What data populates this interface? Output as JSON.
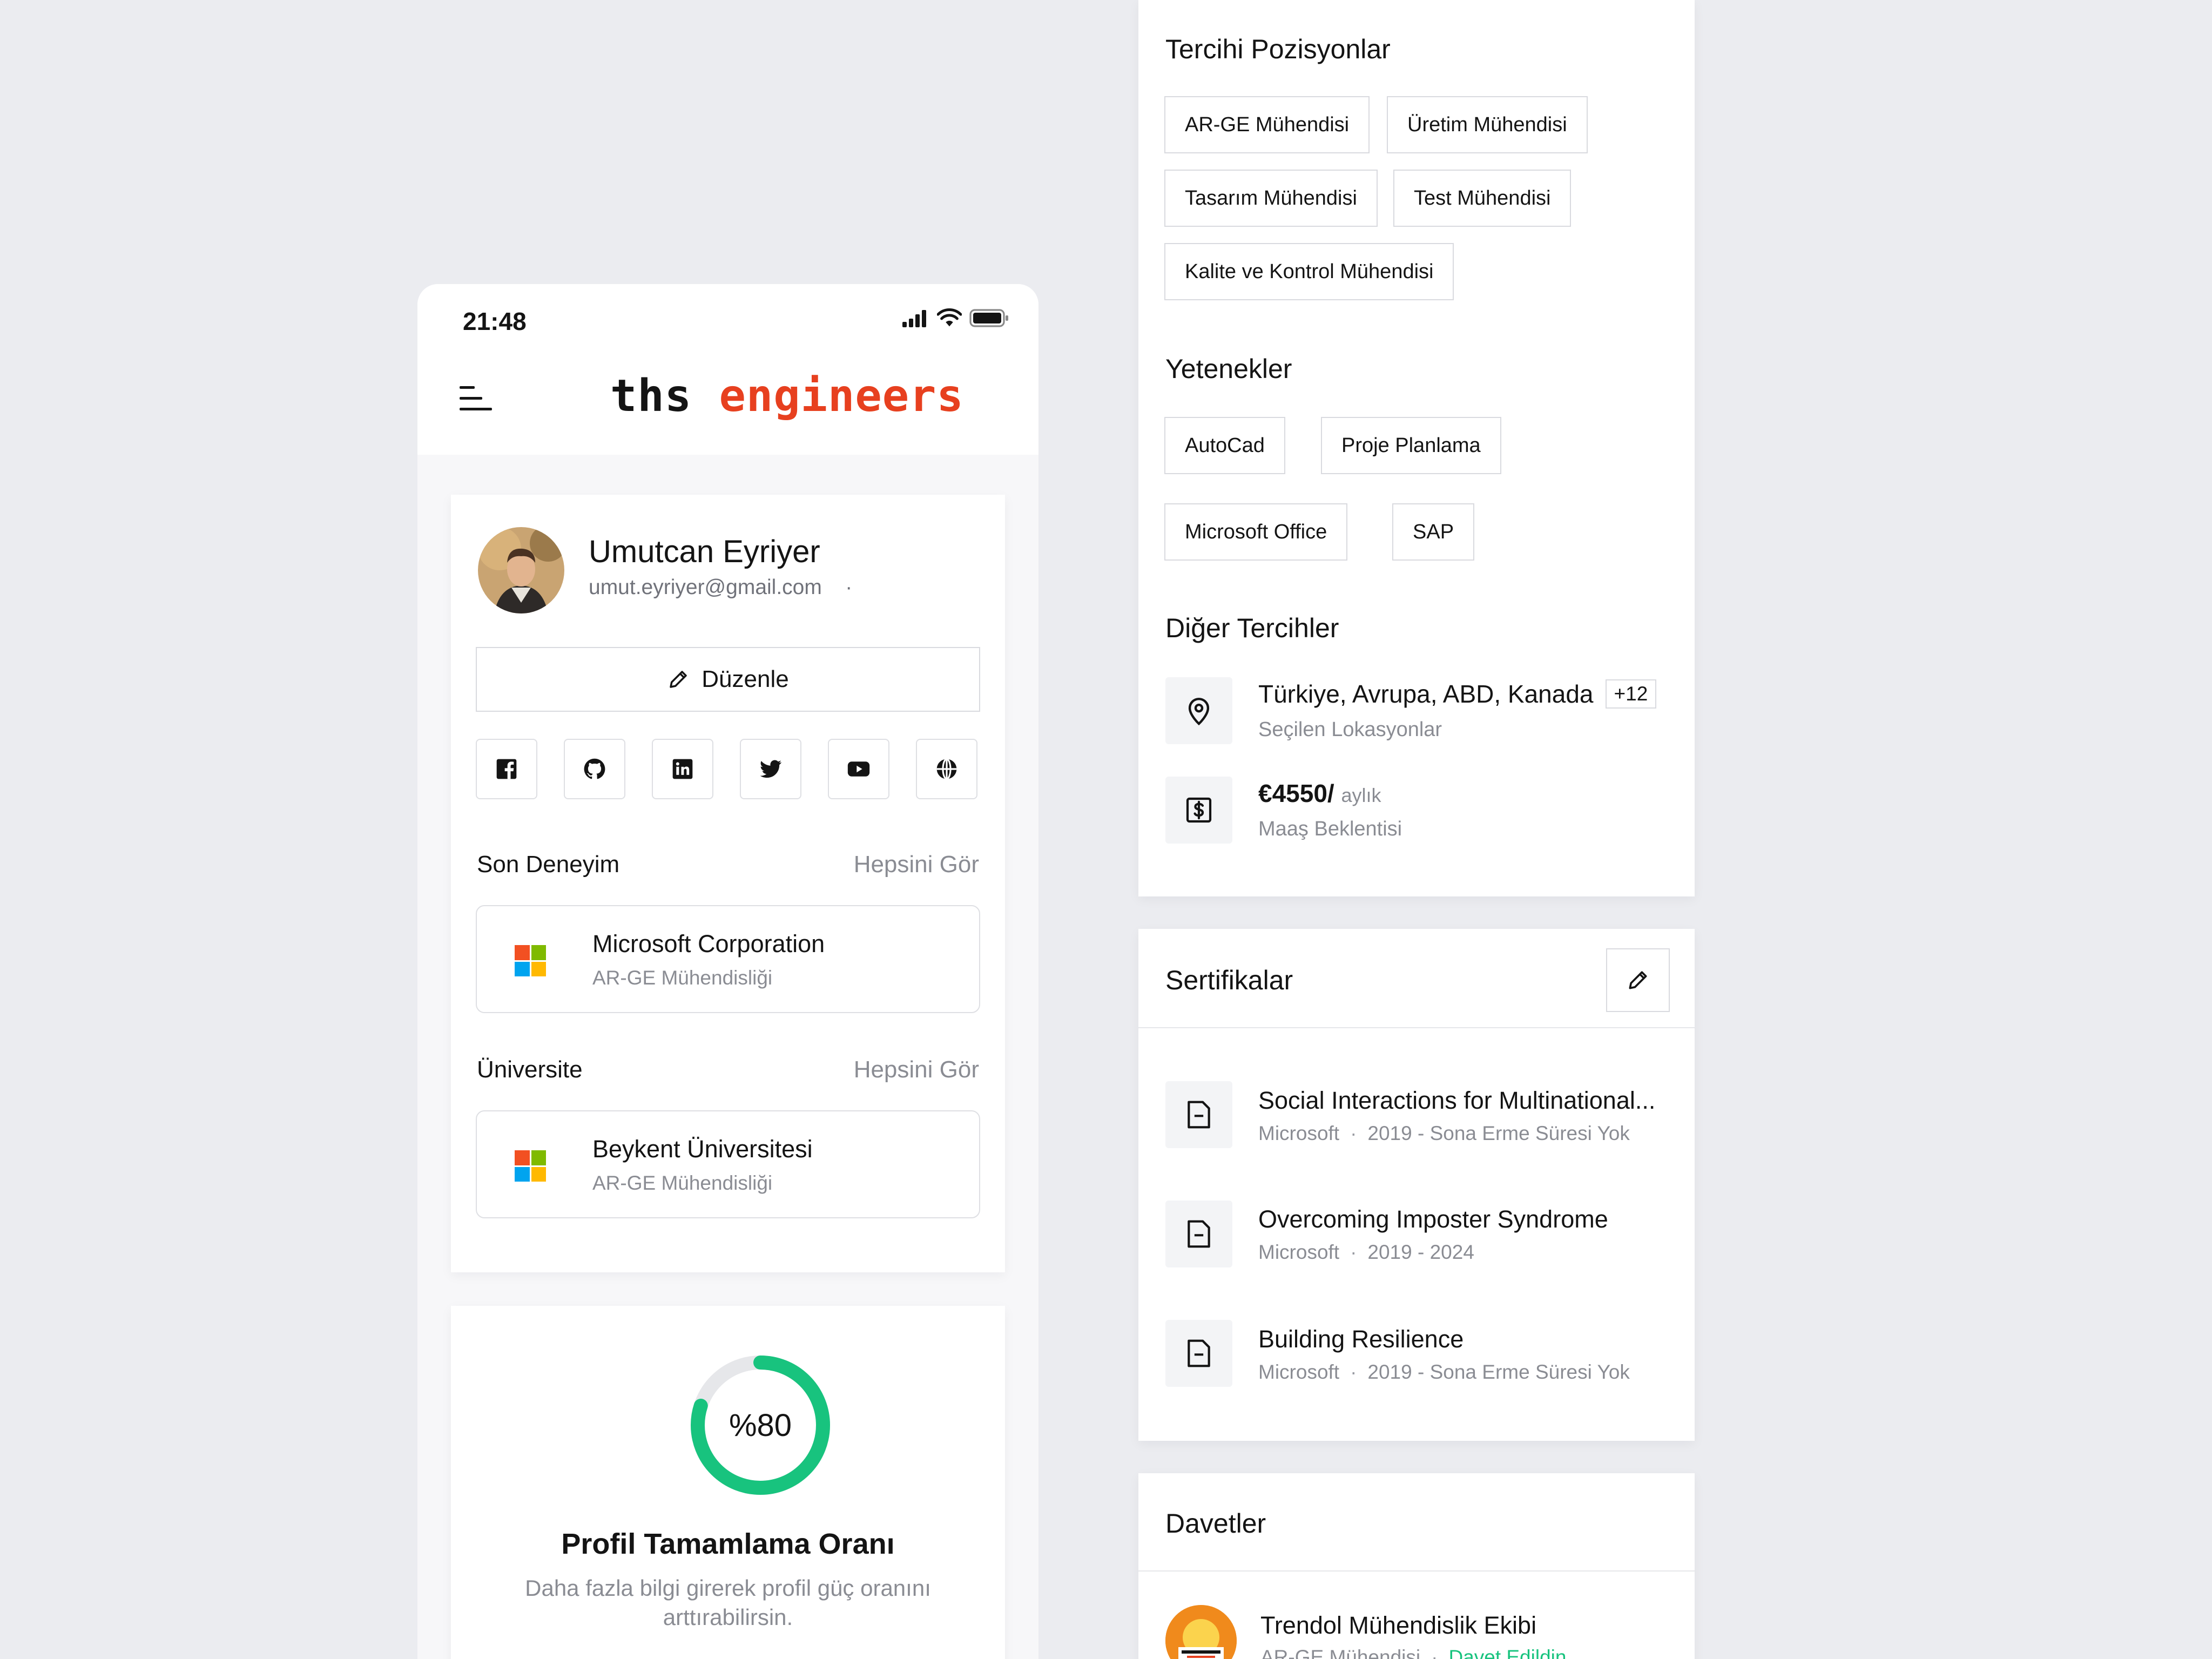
{
  "status_bar": {
    "time": "21:48"
  },
  "header": {
    "logo_part1": "ths",
    "logo_part2": "engineers"
  },
  "profile": {
    "name": "Umutcan Eyriyer",
    "email": "umut.eyriyer@gmail.com",
    "email_suffix": "·",
    "edit_label": "Düzenle",
    "socials": [
      "facebook-icon",
      "github-icon",
      "linkedin-icon",
      "twitter-icon",
      "youtube-icon",
      "globe-icon"
    ]
  },
  "experience": {
    "title": "Son Deneyim",
    "see_all": "Hepsini Gör",
    "company": "Microsoft Corporation",
    "role": "AR-GE Mühendisliği"
  },
  "university": {
    "title": "Üniversite",
    "see_all": "Hepsini Gör",
    "name": "Beykent Üniversitesi",
    "role": "AR-GE Mühendisliği"
  },
  "completion": {
    "percent_label": "%80",
    "percent": 80,
    "title": "Profil Tamamlama Oranı",
    "desc_line1": "Daha fazla bilgi girerek profil güç oranını",
    "desc_line2": "arttırabilirsin.",
    "ring_color": "#18c37e"
  },
  "preferred_positions": {
    "title": "Tercihi Pozisyonlar",
    "items": [
      "AR-GE Mühendisi",
      "Üretim Mühendisi",
      "Tasarım Mühendisi",
      "Test Mühendisi",
      "Kalite ve Kontrol Mühendisi"
    ]
  },
  "skills": {
    "title": "Yetenekler",
    "items": [
      "AutoCad",
      "Proje Planlama",
      "Microsoft Office",
      "SAP"
    ]
  },
  "other_prefs": {
    "title": "Diğer Tercihler",
    "locations": "Türkiye, Avrupa, ABD, Kanada",
    "locations_more": "+12",
    "locations_label": "Seçilen Lokasyonlar",
    "salary": "€4550/",
    "salary_unit": "aylık",
    "salary_label": "Maaş Beklentisi"
  },
  "certificates": {
    "title": "Sertifikalar",
    "items": [
      {
        "title": "Social Interactions for Multinational...",
        "issuer": "Microsoft",
        "period": "2019 - Sona Erme Süresi Yok"
      },
      {
        "title": "Overcoming Imposter Syndrome",
        "issuer": "Microsoft",
        "period": "2019 - 2024"
      },
      {
        "title": "Building Resilience",
        "issuer": "Microsoft",
        "period": "2019 - Sona Erme Süresi Yok"
      }
    ]
  },
  "invitations": {
    "title": "Davetler",
    "team": "Trendol Mühendislik Ekibi",
    "role": "AR-GE Mühendisi",
    "status": "Davet Edildin",
    "status_color": "#18c37e"
  },
  "colors": {
    "accent": "#e7401f",
    "ms_red": "#f25022",
    "ms_green": "#7fba00",
    "ms_blue": "#00a4ef",
    "ms_yellow": "#ffb900"
  }
}
